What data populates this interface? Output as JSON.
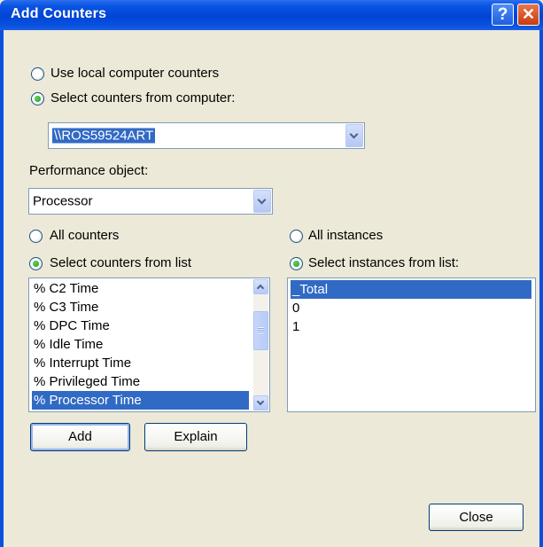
{
  "window": {
    "title": "Add Counters",
    "help_glyph": "?",
    "close_glyph": "✕"
  },
  "computer": {
    "use_local_label": "Use local computer counters",
    "use_local_selected": false,
    "select_from_label": "Select counters from computer:",
    "select_from_selected": true,
    "computer_value": "\\\\ROS59524ART"
  },
  "performance": {
    "label": "Performance object:",
    "value": "Processor"
  },
  "counters": {
    "all_label": "All counters",
    "all_selected": false,
    "from_list_label": "Select counters from list",
    "from_list_selected": true,
    "items": [
      "% C2 Time",
      "% C3 Time",
      "% DPC Time",
      "% Idle Time",
      "% Interrupt Time",
      "% Privileged Time",
      "% Processor Time"
    ],
    "selected_index": 6
  },
  "instances": {
    "all_label": "All instances",
    "all_selected": false,
    "from_list_label": "Select instances from list:",
    "from_list_selected": true,
    "items": [
      "_Total",
      "0",
      "1"
    ],
    "selected_index": 0
  },
  "buttons": {
    "add": "Add",
    "explain": "Explain",
    "close": "Close"
  },
  "icons": {
    "help": "help-icon",
    "close": "close-icon",
    "dropdown": "chevron-down-icon"
  }
}
